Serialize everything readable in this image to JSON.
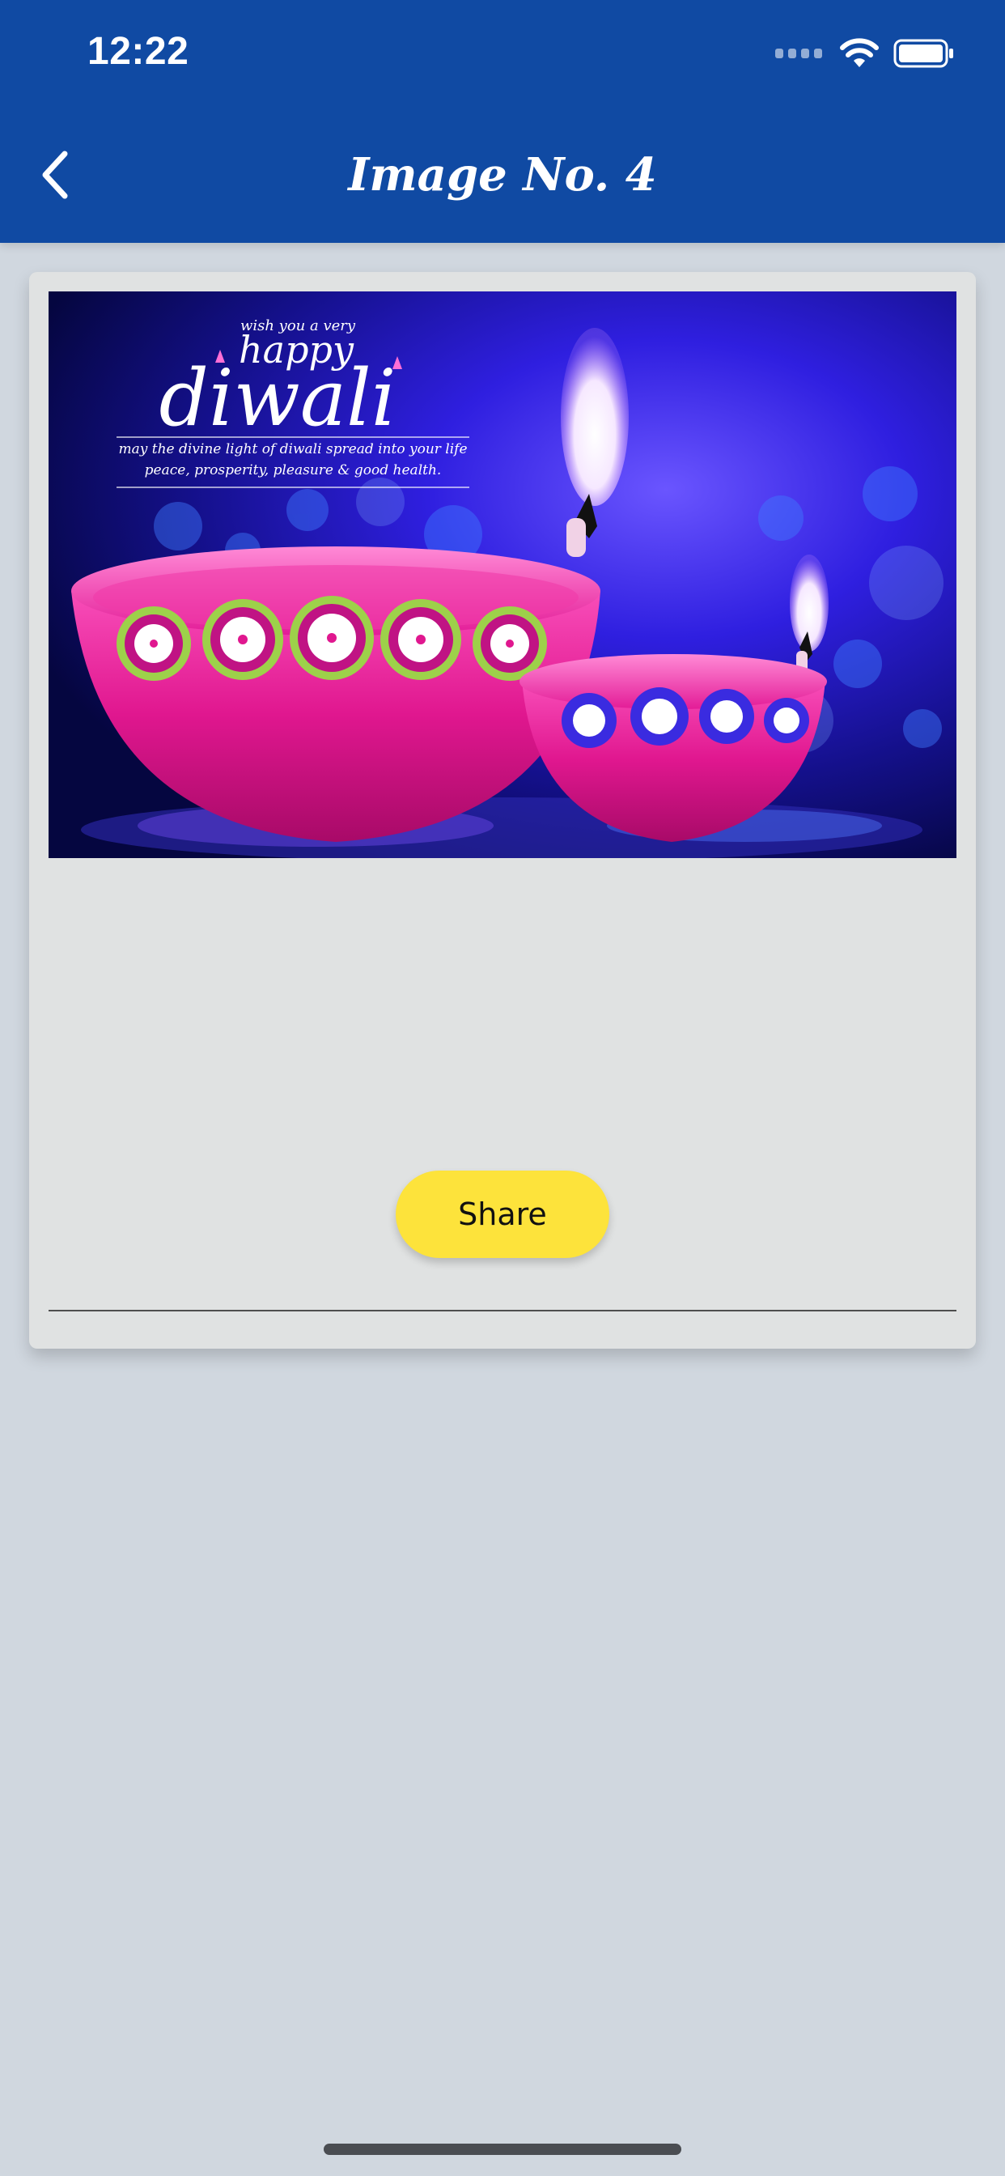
{
  "status_bar": {
    "time": "12:22"
  },
  "header": {
    "title": "Image No. 4",
    "back_icon": "chevron-left-icon",
    "background": "#104aa3"
  },
  "card": {
    "image": {
      "top_line": "wish you a very",
      "happy": "happy",
      "diwali": "diwali",
      "message_line1": "may the divine light of diwali spread into your life",
      "message_line2": "peace, prosperity, pleasure & good health."
    },
    "share_label": "Share",
    "share_color": "#fde33b"
  },
  "colors": {
    "page_background": "#d0d7df",
    "card_background": "#e0e2e2"
  }
}
